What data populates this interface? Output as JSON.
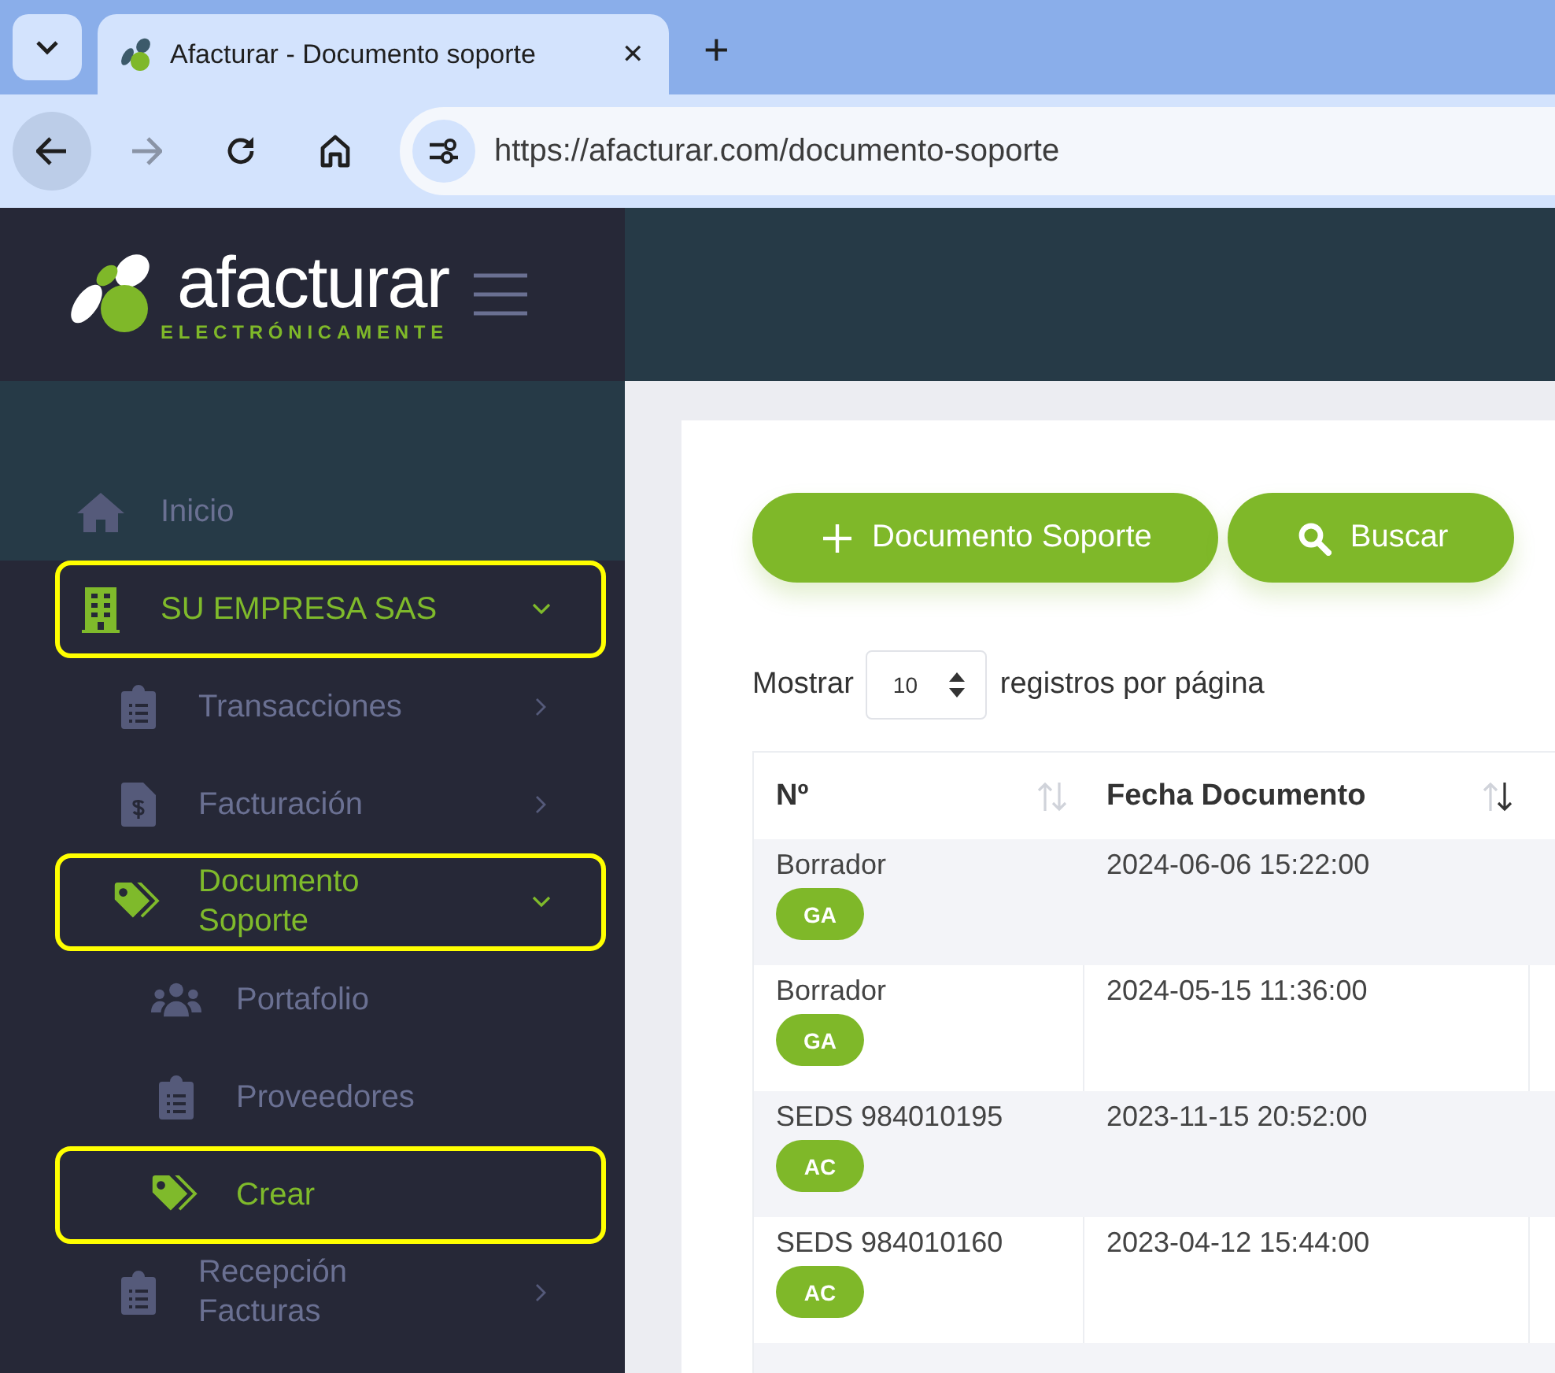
{
  "browser": {
    "tab": {
      "title": "Afacturar - Documento soporte",
      "close": "✕"
    },
    "new_tab": "+",
    "url": "https://afacturar.com/documento-soporte"
  },
  "logo": {
    "name": "afacturar",
    "tagline": "ELECTRÓNICAMENTE"
  },
  "sidebar": {
    "items": [
      {
        "label": "Inicio",
        "selected": true,
        "active": false,
        "highlighted": false,
        "expandable": false,
        "expanded": false
      },
      {
        "label": "SU EMPRESA SAS",
        "selected": false,
        "active": true,
        "highlighted": true,
        "expandable": true,
        "expanded": true,
        "children": [
          {
            "label": "Transacciones",
            "selected": false,
            "active": false,
            "highlighted": false,
            "expandable": true,
            "expanded": false
          },
          {
            "label": "Facturación",
            "selected": false,
            "active": false,
            "highlighted": false,
            "expandable": true,
            "expanded": false
          },
          {
            "label": "Documento Soporte",
            "selected": false,
            "active": true,
            "highlighted": true,
            "expandable": true,
            "expanded": true,
            "children": [
              {
                "label": "Portafolio",
                "selected": false,
                "active": false,
                "highlighted": false,
                "expandable": false,
                "expanded": false
              },
              {
                "label": "Proveedores",
                "selected": false,
                "active": false,
                "highlighted": false,
                "expandable": false,
                "expanded": false
              },
              {
                "label": "Crear",
                "selected": false,
                "active": true,
                "highlighted": true,
                "expandable": false,
                "expanded": false
              }
            ]
          },
          {
            "label": "Recepción Facturas",
            "selected": false,
            "active": false,
            "highlighted": false,
            "expandable": true,
            "expanded": false
          }
        ]
      }
    ]
  },
  "toolbar": {
    "buttons": [
      {
        "label": "Documento Soporte",
        "kind": "add"
      },
      {
        "label": "Buscar",
        "kind": "search"
      }
    ]
  },
  "page_length": {
    "before": "Mostrar",
    "value": "10",
    "after": "registros por página"
  },
  "table": {
    "columns": [
      {
        "label": "Nº",
        "sort_descending": false
      },
      {
        "label": "Fecha Documento",
        "sort_descending": true
      }
    ],
    "rows": [
      {
        "number": "Borrador",
        "badge": "GA",
        "date": "2024-06-06 15:22:00"
      },
      {
        "number": "Borrador",
        "badge": "GA",
        "date": "2024-05-15 11:36:00"
      },
      {
        "number": "SEDS 984010195",
        "badge": "AC",
        "date": "2023-11-15 20:52:00"
      },
      {
        "number": "SEDS 984010160",
        "badge": "AC",
        "date": "2023-04-12 15:44:00"
      }
    ]
  }
}
